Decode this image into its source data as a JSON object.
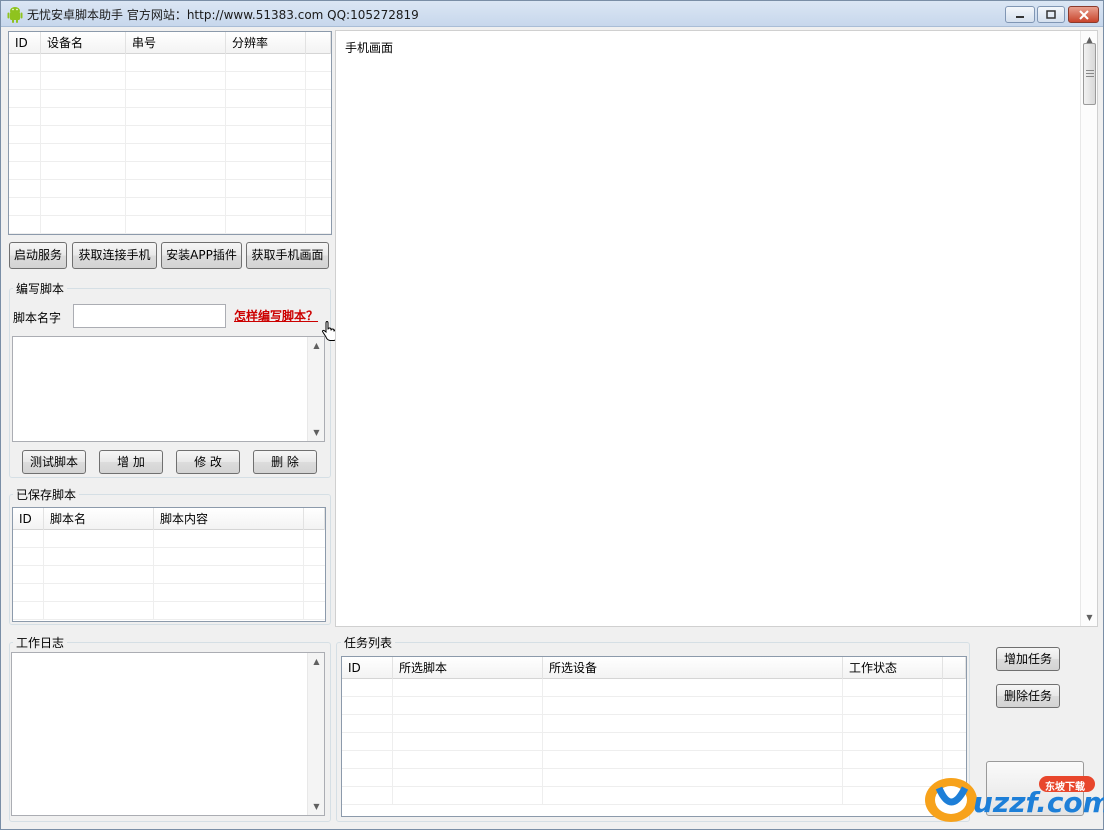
{
  "window": {
    "title": "无忧安卓脚本助手  官方网站：http://www.51383.com  QQ:105272819",
    "minimize_icon": "minimize-icon",
    "maximize_icon": "maximize-icon",
    "close_icon": "close-icon"
  },
  "devices": {
    "columns": [
      "ID",
      "设备名",
      "串号",
      "分辨率"
    ],
    "rows": []
  },
  "device_buttons": {
    "start_service": "启动服务",
    "get_phones": "获取连接手机",
    "install_plugin": "安装APP插件",
    "get_screen": "获取手机画面"
  },
  "screen": {
    "title": "手机画面"
  },
  "edit_script": {
    "group_label": "编写脚本",
    "name_label": "脚本名字",
    "name_value": "",
    "help_link": "怎样编写脚本？",
    "content": "",
    "test_button": "测试脚本",
    "add_button": "增 加",
    "modify_button": "修 改",
    "delete_button": "删 除"
  },
  "saved_scripts": {
    "group_label": "已保存脚本",
    "columns": [
      "ID",
      "脚本名",
      "脚本内容"
    ],
    "rows": []
  },
  "work_log": {
    "group_label": "工作日志",
    "content": ""
  },
  "tasks": {
    "group_label": "任务列表",
    "columns": [
      "ID",
      "所选脚本",
      "所选设备",
      "工作状态"
    ],
    "rows": [],
    "add_task": "增加任务",
    "delete_task": "删除任务"
  },
  "watermark": {
    "brand": "uzzf.com",
    "badge": "东坡下载"
  },
  "colors": {
    "link": "#cc0000",
    "close_button": "#c9442c",
    "titlebar": "#dbe6f4"
  }
}
